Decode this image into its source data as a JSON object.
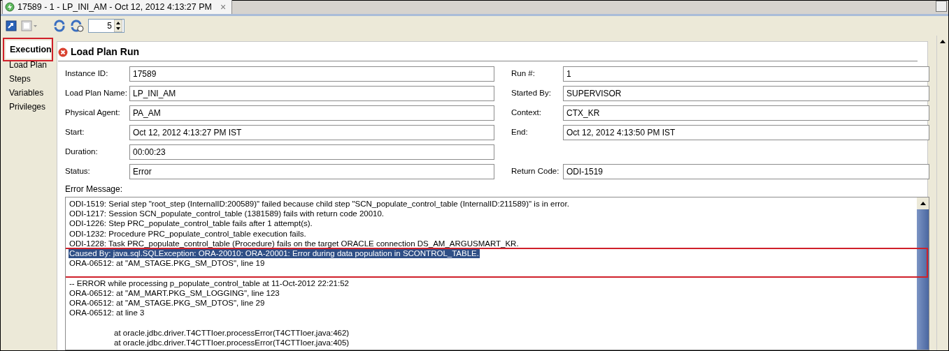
{
  "editor_tab": {
    "title": "17589 - 1 - LP_INI_AM - Oct 12, 2012 4:13:27 PM",
    "close": "×",
    "selected": true
  },
  "toolbar": {
    "refresh_interval": "5"
  },
  "sidebar": {
    "items": [
      {
        "label": "Execution",
        "selected": true,
        "outlined": true
      },
      {
        "label": "Load Plan",
        "selected": false,
        "outlined": false
      },
      {
        "label": "Steps",
        "selected": false,
        "outlined": false
      },
      {
        "label": "Variables",
        "selected": false,
        "outlined": false
      },
      {
        "label": "Privileges",
        "selected": false,
        "outlined": false
      }
    ]
  },
  "panel": {
    "title": "Load Plan Run"
  },
  "fields": [
    [
      {
        "label": "Instance ID:",
        "value": "17589"
      },
      {
        "label": "Run #:",
        "value": "1"
      }
    ],
    [
      {
        "label": "Load Plan Name:",
        "value": "LP_INI_AM"
      },
      {
        "label": "Started By:",
        "value": "SUPERVISOR"
      }
    ],
    [
      {
        "label": "Physical Agent:",
        "value": "PA_AM"
      },
      {
        "label": "Context:",
        "value": "CTX_KR"
      }
    ],
    [
      {
        "label": "Start:",
        "value": "Oct 12, 2012 4:13:27 PM IST"
      },
      {
        "label": "End:",
        "value": "Oct 12, 2012 4:13:50 PM IST"
      }
    ],
    [
      {
        "label": "Duration:",
        "value": "00:00:23"
      }
    ],
    [
      {
        "label": "Status:",
        "value": "Error"
      },
      {
        "label": "Return Code:",
        "value": "ODI-1519"
      }
    ]
  ],
  "error_message": {
    "label": "Error Message:",
    "blocks": [
      {
        "outlined": false,
        "lines": [
          {
            "kind": "message",
            "text": "ODI-1519: Serial step \"root_step (InternalID:200589)\" failed because child step \"SCN_populate_control_table (InternalID:211589)\" is in error.",
            "selected": false
          },
          {
            "kind": "message",
            "text": "ODI-1217: Session SCN_populate_control_table (1381589) fails with return code 20010.",
            "selected": false
          },
          {
            "kind": "message",
            "text": "ODI-1226: Step PRC_populate_control_table fails after 1 attempt(s).",
            "selected": false
          },
          {
            "kind": "message",
            "text": "ODI-1232: Procedure PRC_populate_control_table execution fails.",
            "selected": false
          },
          {
            "kind": "message",
            "text": "ODI-1228: Task PRC_populate_control_table (Procedure) fails on the target ORACLE connection DS_AM_ARGUSMART_KR.",
            "selected": false
          }
        ]
      },
      {
        "outlined": true,
        "lines": [
          {
            "kind": "message",
            "text": "Caused By: java.sql.SQLException: ORA-20010: ORA-20001: Error during data population in SCONTROL_TABLE.",
            "selected": true
          },
          {
            "kind": "message",
            "text": "ORA-06512: at \"AM_STAGE.PKG_SM_DTOS\", line 19",
            "selected": false
          },
          {
            "kind": "blank"
          }
        ]
      },
      {
        "outlined": false,
        "lines": [
          {
            "kind": "message",
            "text": "-- ERROR while processing p_populate_control_table at 11-Oct-2012 22:21:52",
            "selected": false
          },
          {
            "kind": "message",
            "text": "ORA-06512: at \"AM_MART.PKG_SM_LOGGING\", line 123",
            "selected": false
          },
          {
            "kind": "message",
            "text": "ORA-06512: at \"AM_STAGE.PKG_SM_DTOS\", line 29",
            "selected": false
          },
          {
            "kind": "message",
            "text": "ORA-06512: at line 3",
            "selected": false
          },
          {
            "kind": "blank"
          },
          {
            "kind": "stack",
            "text": "at oracle.jdbc.driver.T4CTTIoer.processError(T4CTTIoer.java:462)",
            "selected": false
          },
          {
            "kind": "stack",
            "text": "at oracle.jdbc.driver.T4CTTIoer.processError(T4CTTIoer.java:405)",
            "selected": false
          }
        ]
      }
    ]
  }
}
